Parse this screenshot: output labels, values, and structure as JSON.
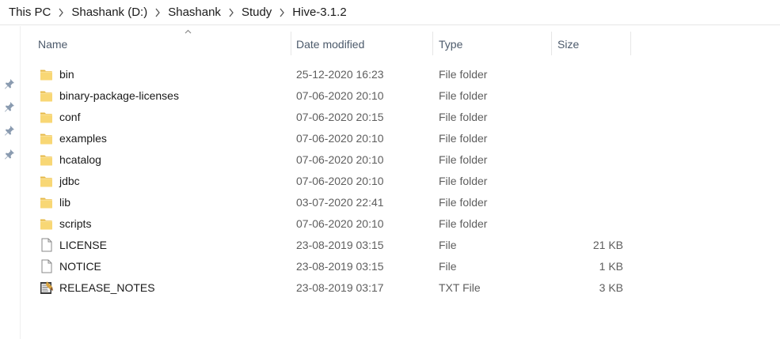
{
  "breadcrumb": [
    "This PC",
    "Shashank (D:)",
    "Shashank",
    "Study",
    "Hive-3.1.2"
  ],
  "columns": {
    "name": "Name",
    "date": "Date modified",
    "type": "Type",
    "size": "Size"
  },
  "sort": {
    "column": "name",
    "direction": "ascending",
    "icon": "chevron-up-icon"
  },
  "pinned_items": 4,
  "colors": {
    "folder": "#f8d775",
    "folder_dark": "#e6b94a",
    "header_text": "#4c5a6b",
    "meta_text": "#5e5e5e"
  },
  "files": [
    {
      "name": "bin",
      "date": "25-12-2020 16:23",
      "type": "File folder",
      "size": "",
      "icon": "folder-icon"
    },
    {
      "name": "binary-package-licenses",
      "date": "07-06-2020 20:10",
      "type": "File folder",
      "size": "",
      "icon": "folder-icon"
    },
    {
      "name": "conf",
      "date": "07-06-2020 20:15",
      "type": "File folder",
      "size": "",
      "icon": "folder-icon"
    },
    {
      "name": "examples",
      "date": "07-06-2020 20:10",
      "type": "File folder",
      "size": "",
      "icon": "folder-icon"
    },
    {
      "name": "hcatalog",
      "date": "07-06-2020 20:10",
      "type": "File folder",
      "size": "",
      "icon": "folder-icon"
    },
    {
      "name": "jdbc",
      "date": "07-06-2020 20:10",
      "type": "File folder",
      "size": "",
      "icon": "folder-icon"
    },
    {
      "name": "lib",
      "date": "03-07-2020 22:41",
      "type": "File folder",
      "size": "",
      "icon": "folder-icon"
    },
    {
      "name": "scripts",
      "date": "07-06-2020 20:10",
      "type": "File folder",
      "size": "",
      "icon": "folder-icon"
    },
    {
      "name": "LICENSE",
      "date": "23-08-2019 03:15",
      "type": "File",
      "size": "21 KB",
      "icon": "file-icon"
    },
    {
      "name": "NOTICE",
      "date": "23-08-2019 03:15",
      "type": "File",
      "size": "1 KB",
      "icon": "file-icon"
    },
    {
      "name": "RELEASE_NOTES",
      "date": "23-08-2019 03:17",
      "type": "TXT File",
      "size": "3 KB",
      "icon": "text-file-icon"
    }
  ]
}
